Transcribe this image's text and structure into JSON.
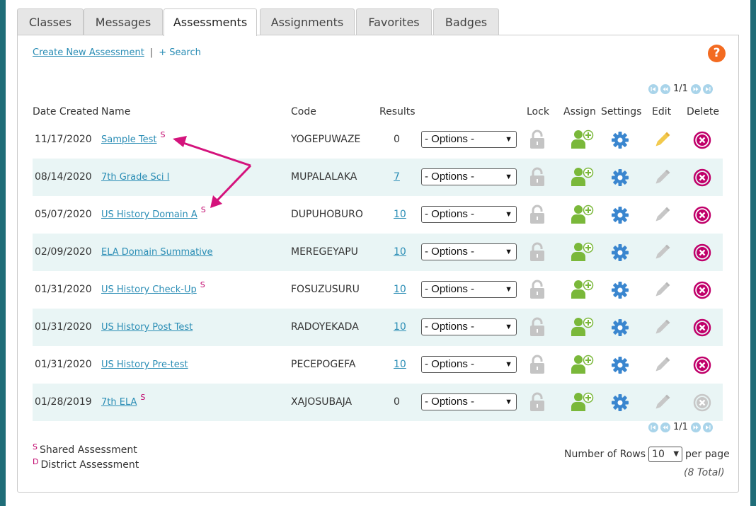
{
  "tabs": [
    {
      "label": "Classes"
    },
    {
      "label": "Messages"
    },
    {
      "label": "Assessments"
    },
    {
      "label": "Assignments"
    },
    {
      "label": "Favorites"
    },
    {
      "label": "Badges"
    }
  ],
  "links": {
    "create": "Create New Assessment",
    "separator": "|",
    "search": "+ Search"
  },
  "help": "?",
  "pager": {
    "text": "1/1"
  },
  "columns": {
    "date": "Date Created",
    "name": "Name",
    "code": "Code",
    "results": "Results",
    "lock": "Lock",
    "assign": "Assign",
    "settings": "Settings",
    "edit": "Edit",
    "delete": "Delete"
  },
  "rows": [
    {
      "date": "11/17/2020",
      "name": "Sample Test",
      "shared": "S",
      "code": "YOGEPUWAZE",
      "results": "0",
      "option": "- Options -",
      "edit_active": true,
      "delete_active": true
    },
    {
      "date": "08/14/2020",
      "name": "7th Grade Sci I",
      "shared": "",
      "code": "MUPALALAKA",
      "results": "7",
      "option": "- Options -",
      "edit_active": false,
      "delete_active": true
    },
    {
      "date": "05/07/2020",
      "name": "US History Domain A",
      "shared": "S",
      "code": "DUPUHOBURO",
      "results": "10",
      "option": "- Options -",
      "edit_active": false,
      "delete_active": true
    },
    {
      "date": "02/09/2020",
      "name": "ELA Domain Summative",
      "shared": "",
      "code": "MEREGEYAPU",
      "results": "10",
      "option": "- Options -",
      "edit_active": false,
      "delete_active": true
    },
    {
      "date": "01/31/2020",
      "name": "US History Check-Up",
      "shared": "S",
      "code": "FOSUZUSURU",
      "results": "10",
      "option": "- Options -",
      "edit_active": false,
      "delete_active": true
    },
    {
      "date": "01/31/2020",
      "name": "US History Post Test",
      "shared": "",
      "code": "RADOYEKADA",
      "results": "10",
      "option": "- Options -",
      "edit_active": false,
      "delete_active": true
    },
    {
      "date": "01/31/2020",
      "name": "US History Pre-test",
      "shared": "",
      "code": "PECEPOGEFA",
      "results": "10",
      "option": "- Options -",
      "edit_active": false,
      "delete_active": true
    },
    {
      "date": "01/28/2019",
      "name": "7th ELA",
      "shared": "S",
      "code": "XAJOSUBAJA",
      "results": "0",
      "option": "- Options -",
      "edit_active": false,
      "delete_active": false
    }
  ],
  "legend": [
    {
      "mark": "S",
      "label": "Shared Assessment"
    },
    {
      "mark": "D",
      "label": "District Assessment"
    }
  ],
  "rows_per_page": {
    "label": "Number of Rows",
    "value": "10",
    "suffix": "per page"
  },
  "total": "(8 Total)",
  "colors": {
    "link": "#2a8db5",
    "accent": "#c0006a",
    "assign": "#7ab83a",
    "settings": "#3a86cf",
    "help": "#f36b21",
    "row_alt": "#e9f5f5"
  }
}
